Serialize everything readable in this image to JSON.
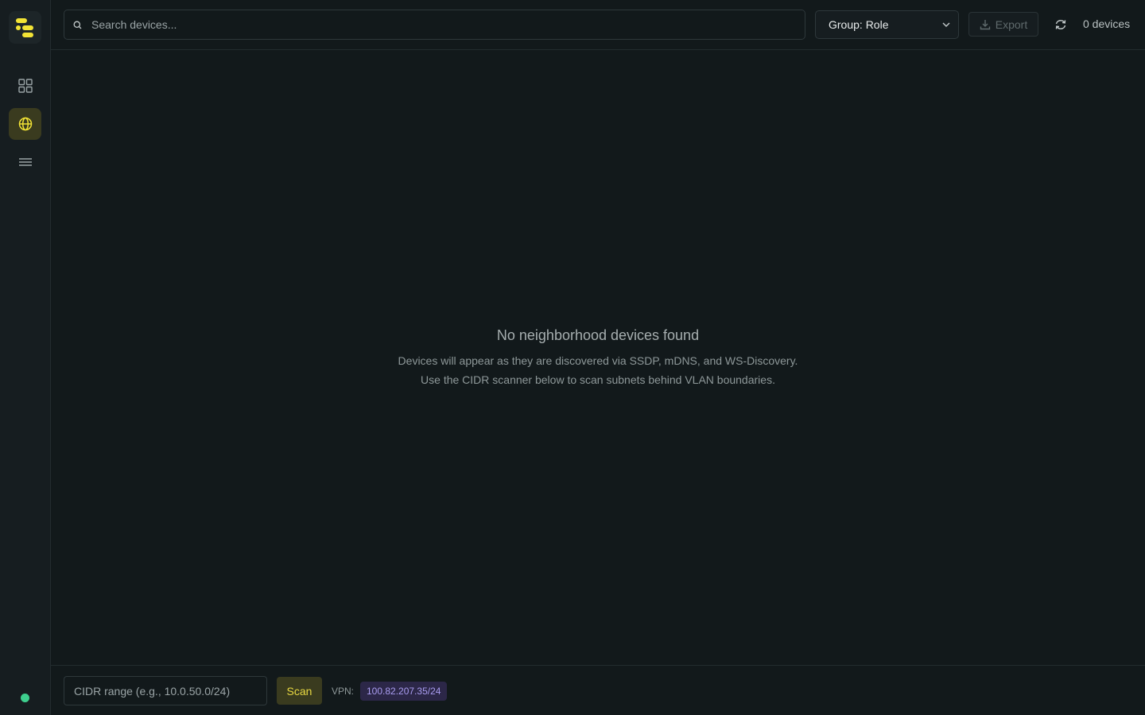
{
  "sidebar": {
    "items": [
      {
        "name": "dashboard",
        "icon": "grid-icon",
        "active": false
      },
      {
        "name": "network",
        "icon": "globe-icon",
        "active": true
      },
      {
        "name": "list",
        "icon": "menu-icon",
        "active": false
      }
    ],
    "status_color": "#3ecf8e"
  },
  "toolbar": {
    "search_placeholder": "Search devices...",
    "group_label": "Group: Role",
    "export_label": "Export",
    "device_count": "0 devices"
  },
  "empty_state": {
    "title": "No neighborhood devices found",
    "line1": "Devices will appear as they are discovered via SSDP, mDNS, and WS-Discovery.",
    "line2": "Use the CIDR scanner below to scan subnets behind VLAN boundaries."
  },
  "scanner": {
    "cidr_placeholder": "CIDR range (e.g., 10.0.50.0/24)",
    "scan_label": "Scan",
    "vpn_label": "VPN:",
    "vpn_value": "100.82.207.35/24"
  },
  "colors": {
    "accent": "#e8d842",
    "background": "#12191b",
    "vpn_badge": "#a99cf0"
  }
}
